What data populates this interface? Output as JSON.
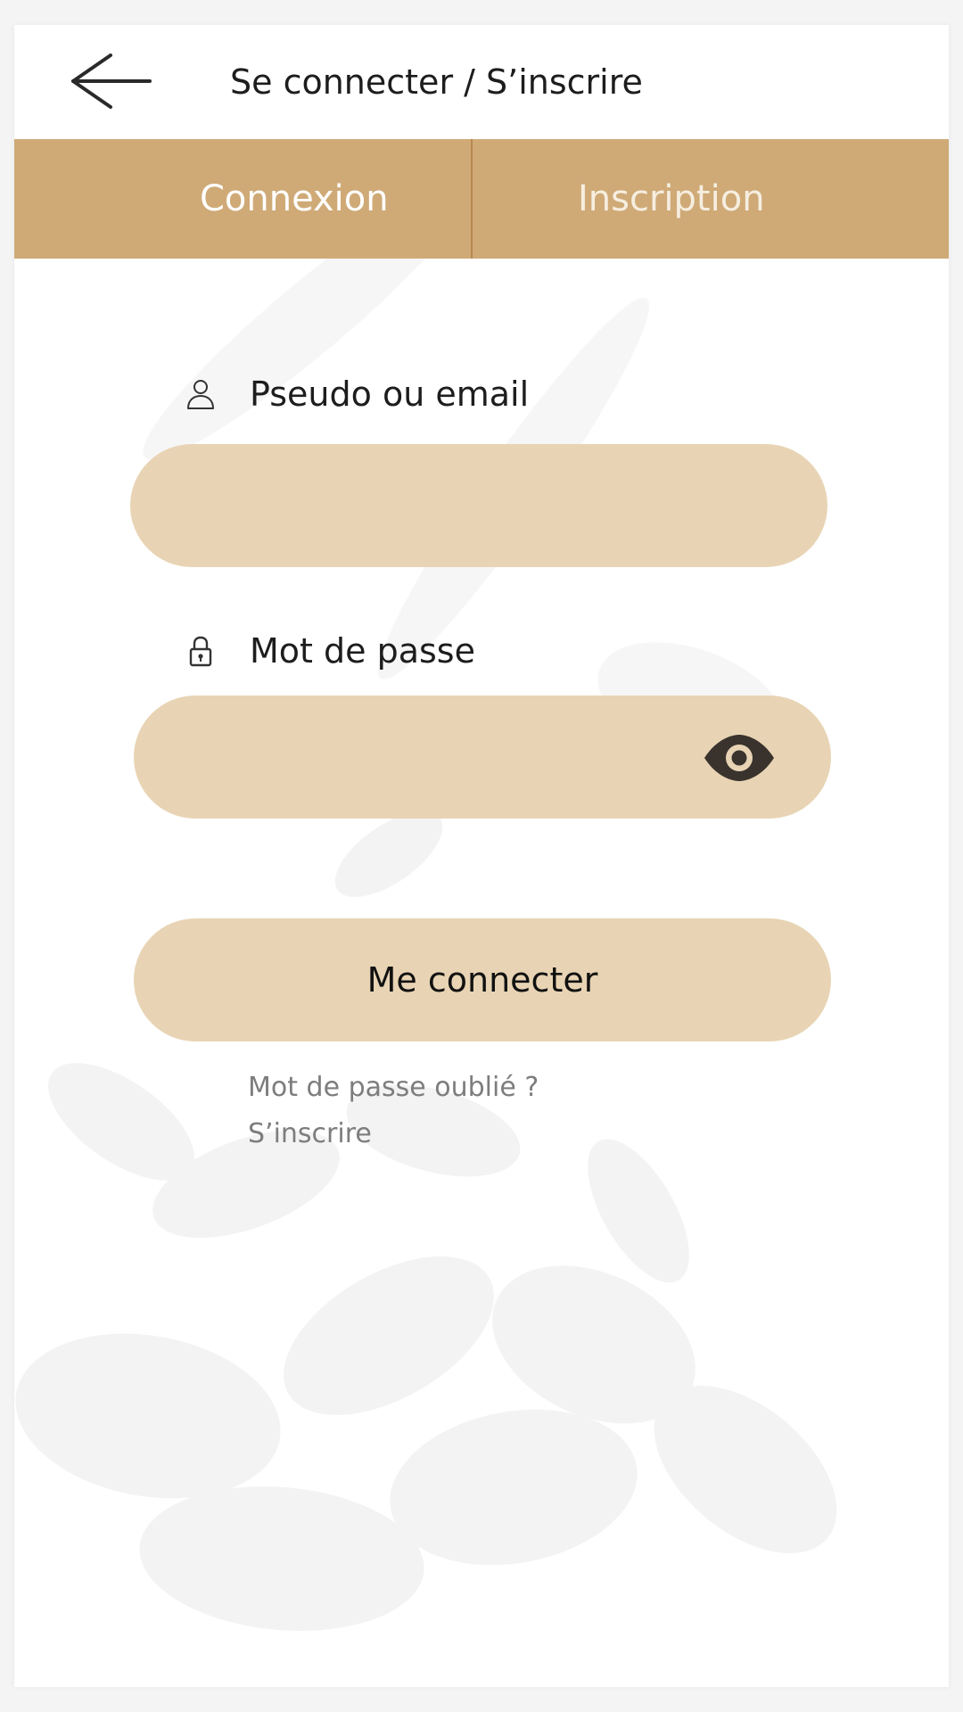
{
  "header": {
    "title": "Se connecter / S’inscrire",
    "back_icon": "arrow-left-icon"
  },
  "tabs": [
    {
      "label": "Connexion",
      "active": true
    },
    {
      "label": "Inscription",
      "active": false
    }
  ],
  "form": {
    "username": {
      "label": "Pseudo ou email",
      "icon": "user-icon",
      "value": "",
      "placeholder": ""
    },
    "password": {
      "label": "Mot de passe",
      "icon": "lock-icon",
      "value": "",
      "placeholder": "",
      "toggle_icon": "eye-icon"
    },
    "submit_label": "Me connecter",
    "forgot_label": "Mot de passe oublié ?",
    "signup_label": "S’inscrire"
  },
  "colors": {
    "tab_bar": "#cfaa77",
    "input_fill": "#e8d4b4",
    "text_dark": "#1d1d1d",
    "link_gray": "#7d7d7d"
  }
}
